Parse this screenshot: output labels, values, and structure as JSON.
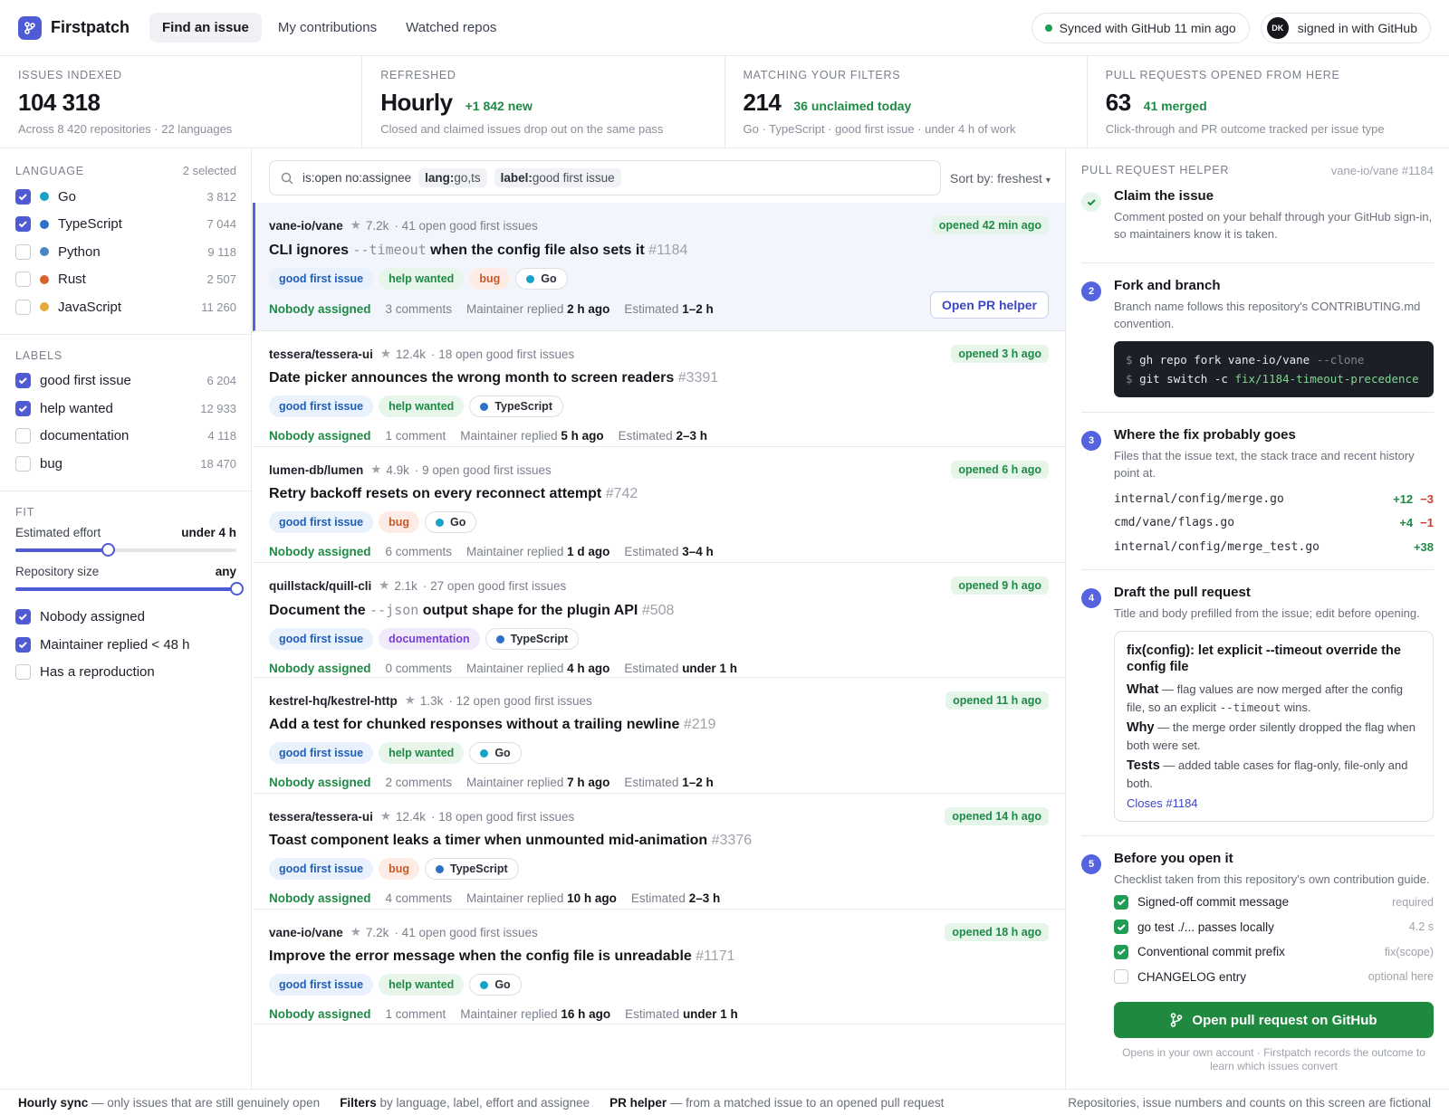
{
  "app": {
    "name": "Firstpatch"
  },
  "nav": {
    "tabs": [
      "Find an issue",
      "My contributions",
      "Watched repos"
    ]
  },
  "header": {
    "sync_status": "Synced with GitHub 11 min ago",
    "avatar_initials": "DK",
    "signin_label": "signed in with GitHub"
  },
  "stats": [
    {
      "label": "ISSUES INDEXED",
      "value": "104 318",
      "extra": "",
      "sub": "Across 8 420 repositories · 22 languages"
    },
    {
      "label": "REFRESHED",
      "value": "Hourly",
      "extra": "+1 842 new",
      "sub": "Closed and claimed issues drop out on the same pass"
    },
    {
      "label": "MATCHING YOUR FILTERS",
      "value": "214",
      "extra": "36 unclaimed today",
      "sub": "Go · TypeScript · good first issue · under 4 h of work"
    },
    {
      "label": "PULL REQUESTS OPENED FROM HERE",
      "value": "63",
      "extra": "41 merged",
      "sub": "Click-through and PR outcome tracked per issue type"
    }
  ],
  "sidebar": {
    "language": {
      "heading": "LANGUAGE",
      "selected": "2 selected",
      "items": [
        {
          "label": "Go",
          "count": "3 812",
          "checked": true,
          "color": "#17a2c8"
        },
        {
          "label": "TypeScript",
          "count": "7 044",
          "checked": true,
          "color": "#2f6fc6"
        },
        {
          "label": "Python",
          "count": "9 118",
          "checked": false,
          "color": "#4a86c5"
        },
        {
          "label": "Rust",
          "count": "2 507",
          "checked": false,
          "color": "#d8622e"
        },
        {
          "label": "JavaScript",
          "count": "11 260",
          "checked": false,
          "color": "#e6a93a"
        }
      ]
    },
    "labels": {
      "heading": "LABELS",
      "items": [
        {
          "label": "good first issue",
          "count": "6 204",
          "checked": true
        },
        {
          "label": "help wanted",
          "count": "12 933",
          "checked": true
        },
        {
          "label": "documentation",
          "count": "4 118",
          "checked": false
        },
        {
          "label": "bug",
          "count": "18 470",
          "checked": false
        }
      ]
    },
    "fit": {
      "heading": "FIT",
      "effort_label": "Estimated effort",
      "effort_value": "under 4 h",
      "effort_level": 0.42,
      "size_label": "Repository size",
      "size_value": "any",
      "size_level": 1.0,
      "options": [
        {
          "label": "Nobody assigned",
          "checked": true
        },
        {
          "label": "Maintainer replied < 48 h",
          "checked": true
        },
        {
          "label": "Has a reproduction",
          "checked": false
        }
      ]
    }
  },
  "search": {
    "query": "is:open no:assignee",
    "chip1_key": "lang:",
    "chip1_val": "go,ts",
    "chip2_key": "label:",
    "chip2_val": "good first issue",
    "sort": "Sort by: freshest"
  },
  "issues": [
    {
      "repo": "vane-io/vane",
      "stars": "7.2k",
      "open_count": "· 41 open good first issues",
      "opened": "opened 42 min ago",
      "title_pre": "CLI ignores ",
      "title_code": "--timeout",
      "title_post": " when the config file also sets it",
      "number": "#1184",
      "tags": [
        "good first issue",
        "help wanted",
        "bug",
        "Go"
      ],
      "assignee": "Nobody assigned",
      "comments": "3 comments",
      "replied_label": "Maintainer replied",
      "replied": "2 h ago",
      "est_label": "Estimated",
      "estimate": "1–2 h",
      "action": "Open PR helper"
    },
    {
      "repo": "tessera/tessera-ui",
      "stars": "12.4k",
      "open_count": "· 18 open good first issues",
      "opened": "opened 3 h ago",
      "title_pre": "Date picker announces the wrong month to screen readers",
      "title_code": "",
      "title_post": "",
      "number": "#3391",
      "tags": [
        "good first issue",
        "help wanted",
        "TypeScript"
      ],
      "assignee": "Nobody assigned",
      "comments": "1 comment",
      "replied_label": "Maintainer replied",
      "replied": "5 h ago",
      "est_label": "Estimated",
      "estimate": "2–3 h"
    },
    {
      "repo": "lumen-db/lumen",
      "stars": "4.9k",
      "open_count": "· 9 open good first issues",
      "opened": "opened 6 h ago",
      "title_pre": "Retry backoff resets on every reconnect attempt",
      "title_code": "",
      "title_post": "",
      "number": "#742",
      "tags": [
        "good first issue",
        "bug",
        "Go"
      ],
      "assignee": "Nobody assigned",
      "comments": "6 comments",
      "replied_label": "Maintainer replied",
      "replied": "1 d ago",
      "est_label": "Estimated",
      "estimate": "3–4 h"
    },
    {
      "repo": "quillstack/quill-cli",
      "stars": "2.1k",
      "open_count": "· 27 open good first issues",
      "opened": "opened 9 h ago",
      "title_pre": "Document the ",
      "title_code": "--json",
      "title_post": " output shape for the plugin API",
      "number": "#508",
      "tags": [
        "good first issue",
        "documentation",
        "TypeScript"
      ],
      "assignee": "Nobody assigned",
      "comments": "0 comments",
      "replied_label": "Maintainer replied",
      "replied": "4 h ago",
      "est_label": "Estimated",
      "estimate": "under 1 h"
    },
    {
      "repo": "kestrel-hq/kestrel-http",
      "stars": "1.3k",
      "open_count": "· 12 open good first issues",
      "opened": "opened 11 h ago",
      "title_pre": "Add a test for chunked responses without a trailing newline",
      "title_code": "",
      "title_post": "",
      "number": "#219",
      "tags": [
        "good first issue",
        "help wanted",
        "Go"
      ],
      "assignee": "Nobody assigned",
      "comments": "2 comments",
      "replied_label": "Maintainer replied",
      "replied": "7 h ago",
      "est_label": "Estimated",
      "estimate": "1–2 h"
    },
    {
      "repo": "tessera/tessera-ui",
      "stars": "12.4k",
      "open_count": "· 18 open good first issues",
      "opened": "opened 14 h ago",
      "title_pre": "Toast component leaks a timer when unmounted mid-animation",
      "title_code": "",
      "title_post": "",
      "number": "#3376",
      "tags": [
        "good first issue",
        "bug",
        "TypeScript"
      ],
      "assignee": "Nobody assigned",
      "comments": "4 comments",
      "replied_label": "Maintainer replied",
      "replied": "10 h ago",
      "est_label": "Estimated",
      "estimate": "2–3 h"
    },
    {
      "repo": "vane-io/vane",
      "stars": "7.2k",
      "open_count": "· 41 open good first issues",
      "opened": "opened 18 h ago",
      "title_pre": "Improve the error message when the config file is unreadable",
      "title_code": "",
      "title_post": "",
      "number": "#1171",
      "tags": [
        "good first issue",
        "help wanted",
        "Go"
      ],
      "assignee": "Nobody assigned",
      "comments": "1 comment",
      "replied_label": "Maintainer replied",
      "replied": "16 h ago",
      "est_label": "Estimated",
      "estimate": "under 1 h"
    }
  ],
  "panel": {
    "heading": "PULL REQUEST HELPER",
    "ref": "vane-io/vane #1184",
    "steps": [
      {
        "num": "",
        "title": "Claim the issue",
        "desc": "Comment posted on your behalf through your GitHub sign-in, so maintainers know it is taken."
      },
      {
        "num": "2",
        "title": "Fork and branch",
        "desc": "Branch name follows this repository's CONTRIBUTING.md convention."
      },
      {
        "num": "3",
        "title": "Where the fix probably goes",
        "desc": "Files that the issue text, the stack trace and recent history point at."
      },
      {
        "num": "4",
        "title": "Draft the pull request",
        "desc": "Title and body prefilled from the issue; edit before opening."
      },
      {
        "num": "5",
        "title": "Before you open it",
        "desc": "Checklist taken from this repository's own contribution guide."
      }
    ],
    "terminal": {
      "prompt": "$",
      "line1_cmd": "gh repo fork vane-io/vane",
      "line1_flag": "--clone",
      "line2_cmd": "git switch -c",
      "line2_branch": "fix/1184-timeout-precedence"
    },
    "files": [
      {
        "path": "internal/config/merge.go",
        "add": "+12",
        "del": "−3"
      },
      {
        "path": "cmd/vane/flags.go",
        "add": "+4",
        "del": "−1"
      },
      {
        "path": "internal/config/merge_test.go",
        "add": "+38",
        "del": ""
      }
    ],
    "draft": {
      "title": "fix(config): let explicit --timeout override the config file",
      "what_label": "What",
      "what_text": " — flag values are now merged after the config file, so an explicit ",
      "what_code": "--timeout",
      "what_end": " wins.",
      "why_label": "Why",
      "why_text": " — the merge order silently dropped the flag when both were set.",
      "tests_label": "Tests",
      "tests_text": " — added table cases for flag-only, file-only and both.",
      "closes": "Closes #1184"
    },
    "checklist": [
      {
        "label": "Signed-off commit message",
        "hint": "required",
        "checked": true
      },
      {
        "label": "go test ./... passes locally",
        "hint": "4.2 s",
        "checked": true
      },
      {
        "label": "Conventional commit prefix",
        "hint": "fix(scope)",
        "checked": true
      },
      {
        "label": "CHANGELOG entry",
        "hint": "optional here",
        "checked": false
      }
    ],
    "open_button": "Open pull request on GitHub",
    "footnote": "Opens in your own account · Firstpatch records the outcome to learn which issues convert"
  },
  "footer": {
    "items": [
      {
        "bold": "Hourly sync",
        "text": " — only issues that are still genuinely open"
      },
      {
        "bold": "Filters",
        "text": " by language, label, effort and assignee"
      },
      {
        "bold": "PR helper",
        "text": " — from a matched issue to an opened pull request"
      }
    ],
    "right": "Repositories, issue numbers and counts on this screen are fictional"
  },
  "colors": {
    "accent": "#4f5bd5",
    "green": "#1f8a45",
    "go": "#17a2c8",
    "typescript": "#2f6fc6"
  }
}
